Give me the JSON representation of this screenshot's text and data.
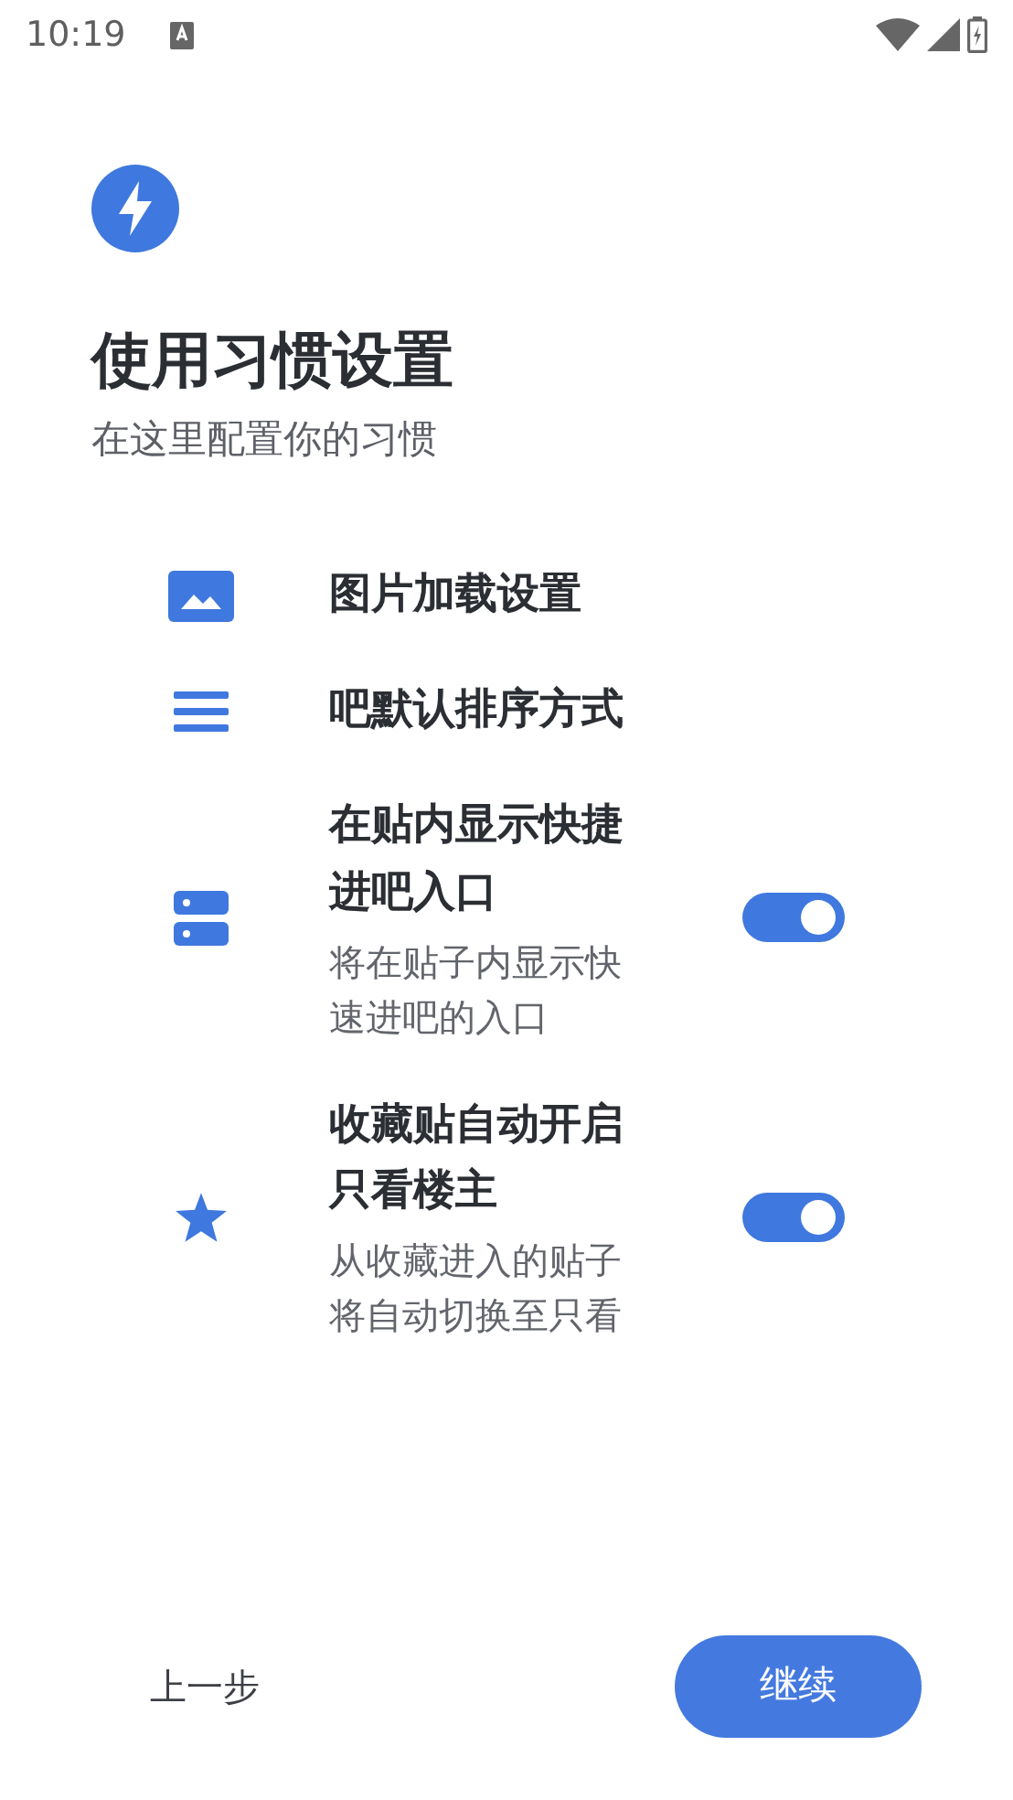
{
  "status_bar": {
    "time": "10:19"
  },
  "header": {
    "title": "使用习惯设置",
    "subtitle": "在这里配置你的习惯"
  },
  "settings": [
    {
      "kind": "link",
      "title": "图片加载设置"
    },
    {
      "kind": "link",
      "title": "吧默认排序方式"
    },
    {
      "kind": "toggle",
      "title": "在贴内显示快捷进吧入口",
      "description": "将在贴子内显示快速进吧的入口",
      "on": true
    },
    {
      "kind": "toggle",
      "title": "收藏贴自动开启只看楼主",
      "description": "从收藏进入的贴子将自动切换至只看",
      "on": true
    }
  ],
  "footer": {
    "back": "上一步",
    "next": "继续"
  }
}
